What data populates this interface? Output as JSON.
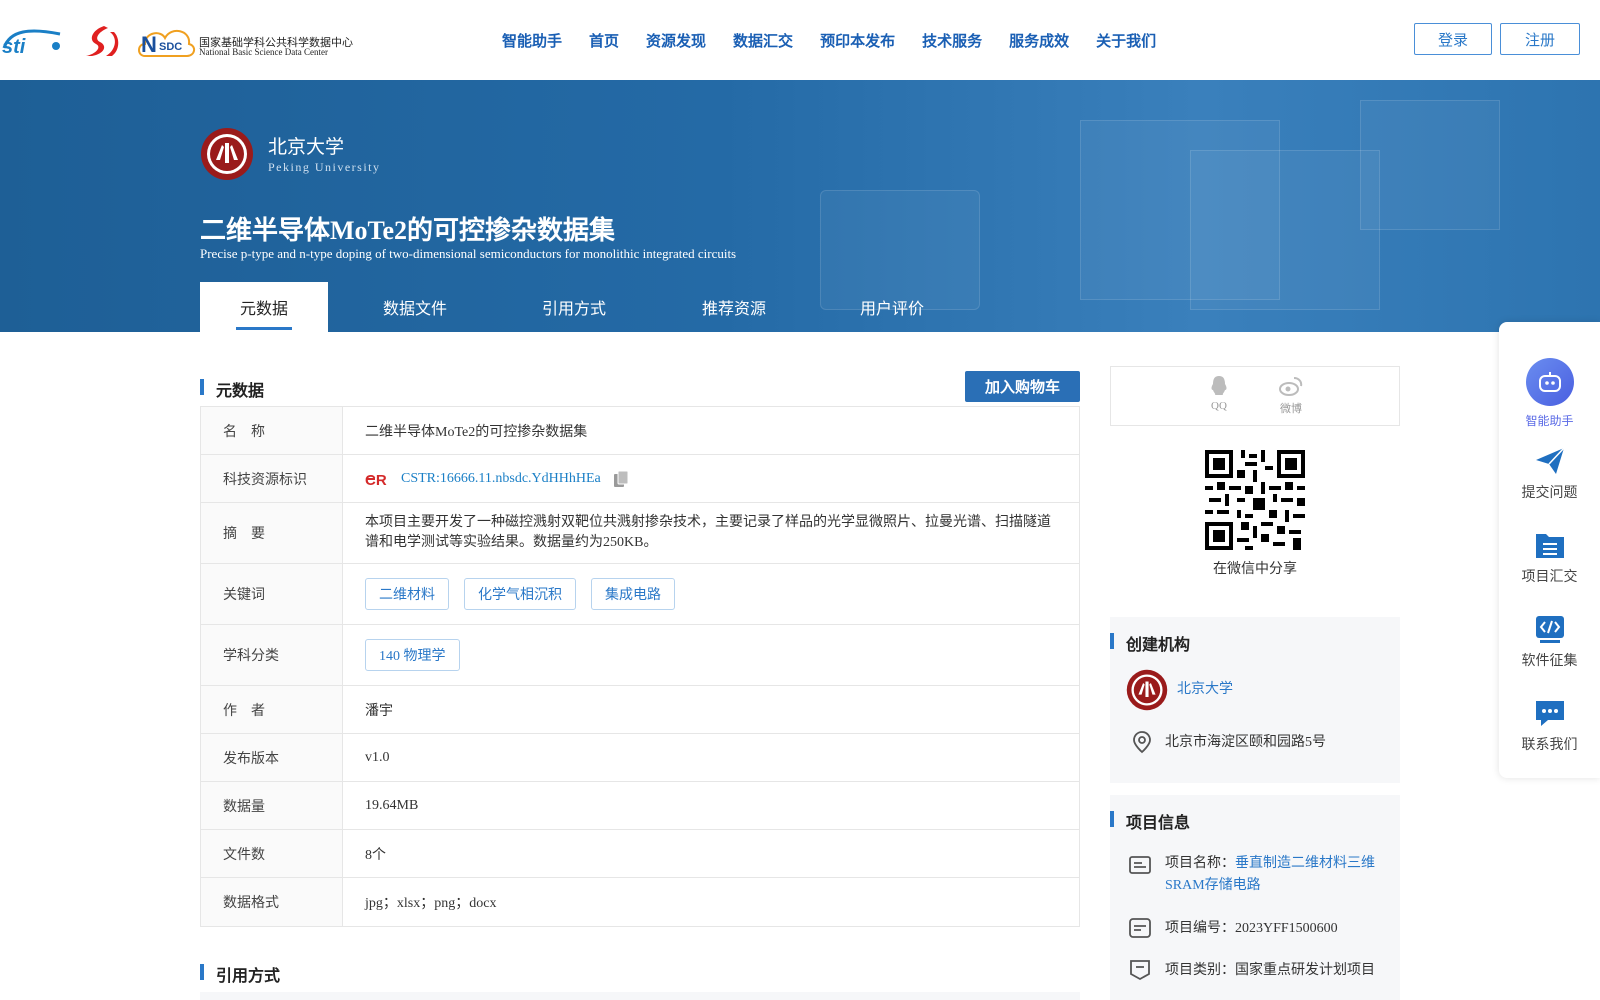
{
  "header": {
    "nsdc_cn": "国家基础学科公共科学数据中心",
    "nsdc_en": "National Basic Science Data Center",
    "nav": [
      "智能助手",
      "首页",
      "资源发现",
      "数据汇交",
      "预印本发布",
      "技术服务",
      "服务成效",
      "关于我们"
    ],
    "login": "登录",
    "register": "注册"
  },
  "banner": {
    "inst_name": "北京大学",
    "inst_en": "Peking University",
    "title": "二维半导体MoTe2的可控掺杂数据集",
    "subtitle": "Precise p-type and n-type doping of two-dimensional semiconductors for monolithic integrated circuits",
    "tabs": [
      "元数据",
      "数据文件",
      "引用方式",
      "推荐资源",
      "用户评价"
    ]
  },
  "metadata": {
    "section_title": "元数据",
    "cart_button": "加入购物车",
    "rows": {
      "name_k": "名　称",
      "name_v": "二维半导体MoTe2的可控掺杂数据集",
      "cstr_k": "科技资源标识",
      "cstr_v": "CSTR:16666.11.nbsdc.YdHHhHEa",
      "abstract_k": "摘　要",
      "abstract_v": "本项目主要开发了一种磁控溅射双靶位共溅射掺杂技术，主要记录了样品的光学显微照片、拉曼光谱、扫描隧道谱和电学测试等实验结果。数据量约为250KB。",
      "keywords_k": "关键词",
      "keywords": [
        "二维材料",
        "化学气相沉积",
        "集成电路"
      ],
      "subject_k": "学科分类",
      "subject_v": "140 物理学",
      "author_k": "作　者",
      "author_v": "潘宇",
      "version_k": "发布版本",
      "version_v": "v1.0",
      "size_k": "数据量",
      "size_v": "19.64MB",
      "files_k": "文件数",
      "files_v": "8个",
      "format_k": "数据格式",
      "format_v": "jpg；xlsx；png；docx"
    }
  },
  "citation": {
    "section_title": "引用方式"
  },
  "share": {
    "qq": "QQ",
    "weibo": "微博",
    "wechat": "在微信中分享"
  },
  "org": {
    "title": "创建机构",
    "name": "北京大学",
    "address": "北京市海淀区颐和园路5号"
  },
  "project": {
    "title": "项目信息",
    "name_label": "项目名称：",
    "name_value": "垂直制造二维材料三维SRAM存储电路",
    "code_label": "项目编号：",
    "code_value": "2023YFF1500600",
    "type_label": "项目类别：",
    "type_value": "国家重点研发计划项目"
  },
  "float": {
    "ai": "智能助手",
    "submit": "提交问题",
    "collect": "项目汇交",
    "software": "软件征集",
    "contact": "联系我们"
  },
  "colors": {
    "accent": "#2a78c8",
    "banner": "#1e5f96",
    "ai_purple": "#5a6ae6"
  }
}
